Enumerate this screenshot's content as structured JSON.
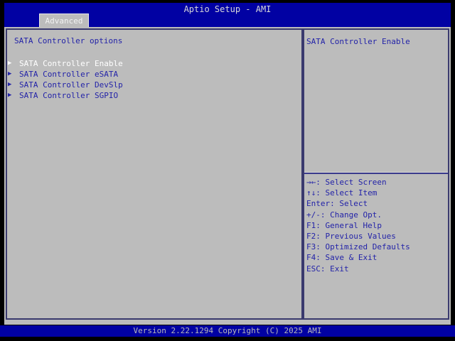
{
  "header": {
    "title": "Aptio Setup - AMI",
    "tabs": [
      {
        "label": "Advanced",
        "active": true
      }
    ]
  },
  "left_panel": {
    "title": "SATA Controller options",
    "items": [
      {
        "label": "SATA Controller Enable",
        "selected": true
      },
      {
        "label": "SATA Controller eSATA",
        "selected": false
      },
      {
        "label": "SATA Controller DevSlp",
        "selected": false
      },
      {
        "label": "SATA Controller SGPIO",
        "selected": false
      }
    ]
  },
  "right_panel": {
    "help_text": "SATA Controller Enable",
    "hotkeys": [
      "→←: Select Screen",
      "↑↓: Select Item",
      "Enter: Select",
      "+/-: Change Opt.",
      "F1: General Help",
      "F2: Previous Values",
      "F3: Optimized Defaults",
      "F4: Save & Exit",
      "ESC: Exit"
    ]
  },
  "footer": {
    "version_text": "Version 2.22.1294 Copyright (C) 2025 AMI"
  },
  "icons": {
    "submenu_arrow": "▶"
  },
  "colors": {
    "header_blue": "#0101a3",
    "background_gray": "#bcbcbc",
    "text_navy": "#2323a8",
    "border_navy": "#3a3a6e",
    "selected_text": "#ffffff"
  }
}
